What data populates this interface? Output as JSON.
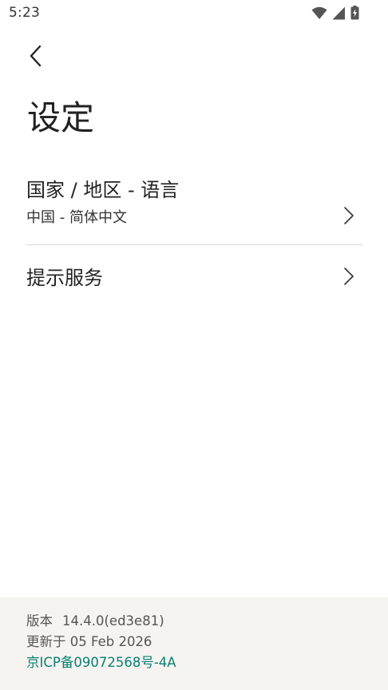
{
  "status_bar": {
    "time": "5:23",
    "icons": [
      "wifi-icon",
      "cell-signal-icon",
      "battery-charging-icon"
    ]
  },
  "header": {
    "back_icon": "chevron-left-icon",
    "title": "设定"
  },
  "settings": [
    {
      "title": "国家 / 地区 - 语言",
      "subtitle": "中国 - 简体中文",
      "icon": "chevron-right-icon"
    },
    {
      "title": "提示服务",
      "icon": "chevron-right-icon"
    }
  ],
  "footer": {
    "version_label": "版本",
    "version_value": "14.4.0(ed3e81)",
    "updated_text": "更新于 05 Feb 2026",
    "icp_text": "京ICP备09072568号-4A"
  },
  "colors": {
    "link": "#0a7f73",
    "footer_background": "#f5f4f0",
    "divider": "#d6d6d6"
  }
}
